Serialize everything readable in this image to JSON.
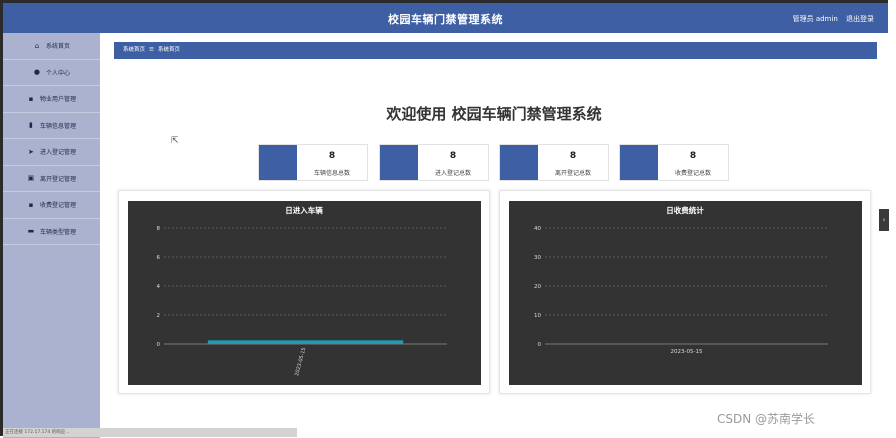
{
  "header": {
    "title": "校园车辆门禁管理系统",
    "user_label": "管理员 admin",
    "logout_label": "退出登录"
  },
  "sidebar": {
    "items": [
      {
        "label": "系统首页",
        "icon": "home-icon",
        "glyph": "⌂"
      },
      {
        "label": "个人中心",
        "icon": "user-icon",
        "glyph": "●"
      },
      {
        "label": "物业用户管理",
        "icon": "grid-icon",
        "glyph": "▪"
      },
      {
        "label": "车辆信息管理",
        "icon": "bar-chart-icon",
        "glyph": "▮"
      },
      {
        "label": "进入登记管理",
        "icon": "send-icon",
        "glyph": "➤"
      },
      {
        "label": "离开登记管理",
        "icon": "trash-icon",
        "glyph": "▣"
      },
      {
        "label": "收费登记管理",
        "icon": "grid-icon",
        "glyph": "▪"
      },
      {
        "label": "车辆类型管理",
        "icon": "card-icon",
        "glyph": "▬"
      }
    ]
  },
  "breadcrumb": {
    "first": "系统首页",
    "separator": "☰",
    "second": "系统首页"
  },
  "welcome": "欢迎使用 校园车辆门禁管理系统",
  "stats": [
    {
      "value": "8",
      "label": "车辆信息总数"
    },
    {
      "value": "8",
      "label": "进入登记总数"
    },
    {
      "value": "8",
      "label": "离开登记总数"
    },
    {
      "value": "8",
      "label": "收费登记总数"
    }
  ],
  "colors": {
    "primary": "#3f5fa4",
    "sidebar": "#aab2cf",
    "chart_bg": "#333333",
    "bar": "#1f9bb3"
  },
  "chart_data": [
    {
      "type": "bar",
      "title": "日进入车辆",
      "categories": [
        "2023-05-15"
      ],
      "values": [
        0.15
      ],
      "ylim": [
        0,
        8
      ],
      "yticks": [
        0,
        2,
        4,
        6,
        8
      ],
      "xlabel": "",
      "ylabel": "",
      "grid": true,
      "x_label_rotated": true
    },
    {
      "type": "bar",
      "title": "日收费统计",
      "categories": [
        "2023-05-15"
      ],
      "values": [
        0
      ],
      "ylim": [
        0,
        40
      ],
      "yticks": [
        0,
        10,
        20,
        30,
        40
      ],
      "xlabel": "",
      "ylabel": "",
      "grid": true,
      "x_label_rotated": false
    }
  ],
  "status_text": "正在连接 172.17.174 的响应...",
  "watermark": "CSDN @苏南学长",
  "right_tab_glyph": "‹"
}
